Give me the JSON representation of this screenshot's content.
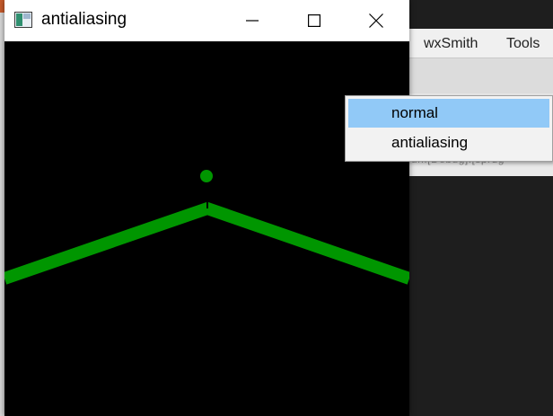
{
  "app_window": {
    "title": "antialiasing",
    "controls": {
      "minimize": "minimize",
      "maximize": "maximize",
      "close": "close"
    }
  },
  "background_app": {
    "menu": [
      "wxSmith",
      "Tools"
    ],
    "status_fragment": "un.[Debug].[sprdg"
  },
  "popup_menu": {
    "items": [
      {
        "label": "normal",
        "selected": true
      },
      {
        "label": "antialiasing",
        "selected": false
      }
    ]
  },
  "colors": {
    "canvas_bg": "#000000",
    "line": "#009600",
    "selection": "#91c9f7"
  },
  "icons": {
    "app": "app-window-icon",
    "minimize": "minimize-icon",
    "maximize": "maximize-icon",
    "close": "close-icon"
  }
}
